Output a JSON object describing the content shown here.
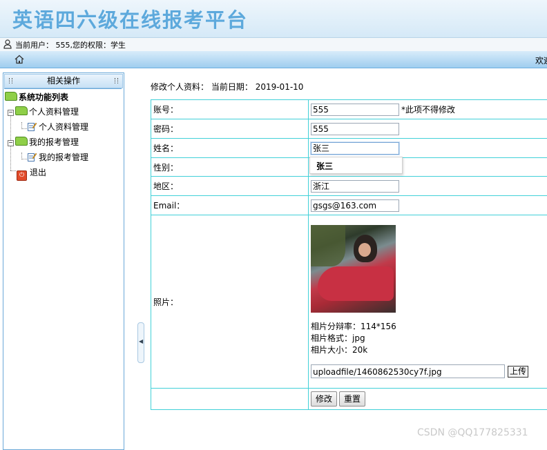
{
  "app": {
    "title": "英语四六级在线报考平台"
  },
  "userbar": {
    "text": "当前用户：  555,您的权限：学生"
  },
  "navbar": {
    "welcome": "欢迎"
  },
  "sidebar": {
    "header": "相关操作",
    "tree": {
      "root": "系统功能列表",
      "groups": [
        {
          "label": "个人资料管理",
          "child": "个人资料管理"
        },
        {
          "label": "我的报考管理",
          "child": "我的报考管理"
        }
      ],
      "exit": "退出"
    }
  },
  "main": {
    "info_label": "修改个人资料：",
    "date_label": "当前日期：",
    "date_value": "2019-01-10",
    "form": {
      "account": {
        "label": "账号：",
        "value": "555",
        "note": "*此项不得修改"
      },
      "password": {
        "label": "密码：",
        "value": "555"
      },
      "name": {
        "label": "姓名：",
        "value": "张三",
        "suggestion": "张三"
      },
      "gender": {
        "label": "性别："
      },
      "region": {
        "label": "地区：",
        "value": "浙江"
      },
      "email": {
        "label": "Email：",
        "value": "gsgs@163.com"
      },
      "photo": {
        "label": "照片：",
        "resolution": "相片分辩率：114*156",
        "format": "相片格式：jpg",
        "size": "相片大小：20k",
        "file_value": "uploadfile/1460862530cy7f.jpg",
        "upload_label": "上传"
      },
      "buttons": {
        "modify": "修改",
        "reset": "重置"
      }
    }
  },
  "watermark": "CSDN @QQ177825331",
  "colors": {
    "title": "#5da9dc",
    "table_border": "#40d0d8",
    "nav": "#9fcdef"
  }
}
